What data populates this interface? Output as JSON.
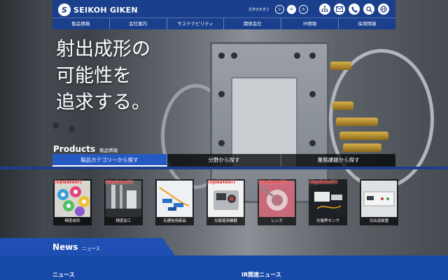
{
  "header": {
    "logo_mark": "S",
    "logo_text": "SEIKOH GIKEN",
    "font_size_label": "文字の大きさ",
    "font_sizes": [
      "小",
      "中",
      "大"
    ],
    "icons": [
      "sitemap-icon",
      "mail-icon",
      "phone-icon",
      "search-icon",
      "globe-icon"
    ],
    "nav": [
      "製品情報",
      "会社案内",
      "サステナビリティ",
      "関係会社",
      "IR情報",
      "採用情報"
    ]
  },
  "hero": {
    "copy": "射出成形の\n可能性を\n追求する。"
  },
  "products": {
    "title": "Products",
    "subtitle": "製品情報",
    "tabs": [
      "製品カテゴリーから探す",
      "分野から探す",
      "業務課題から探す"
    ],
    "cards": [
      {
        "label": "精密成形",
        "updated": "(Updated!)"
      },
      {
        "label": "精密加工",
        "updated": "(Updated!)"
      },
      {
        "label": "光通信用部品",
        "updated": ""
      },
      {
        "label": "光製造用機器",
        "updated": "(Updated!)"
      },
      {
        "label": "レンズ",
        "updated": "(Updated!)"
      },
      {
        "label": "光電界センサ",
        "updated": "(Updated!)"
      },
      {
        "label": "光伝送装置",
        "updated": ""
      }
    ]
  },
  "news": {
    "title": "News",
    "subtitle": "ニュース",
    "col1": "ニュース",
    "col2": "IR関連ニュース"
  },
  "colors": {
    "brand": "#1a3f8c",
    "accent": "#2659c2",
    "updated": "#e02020"
  }
}
